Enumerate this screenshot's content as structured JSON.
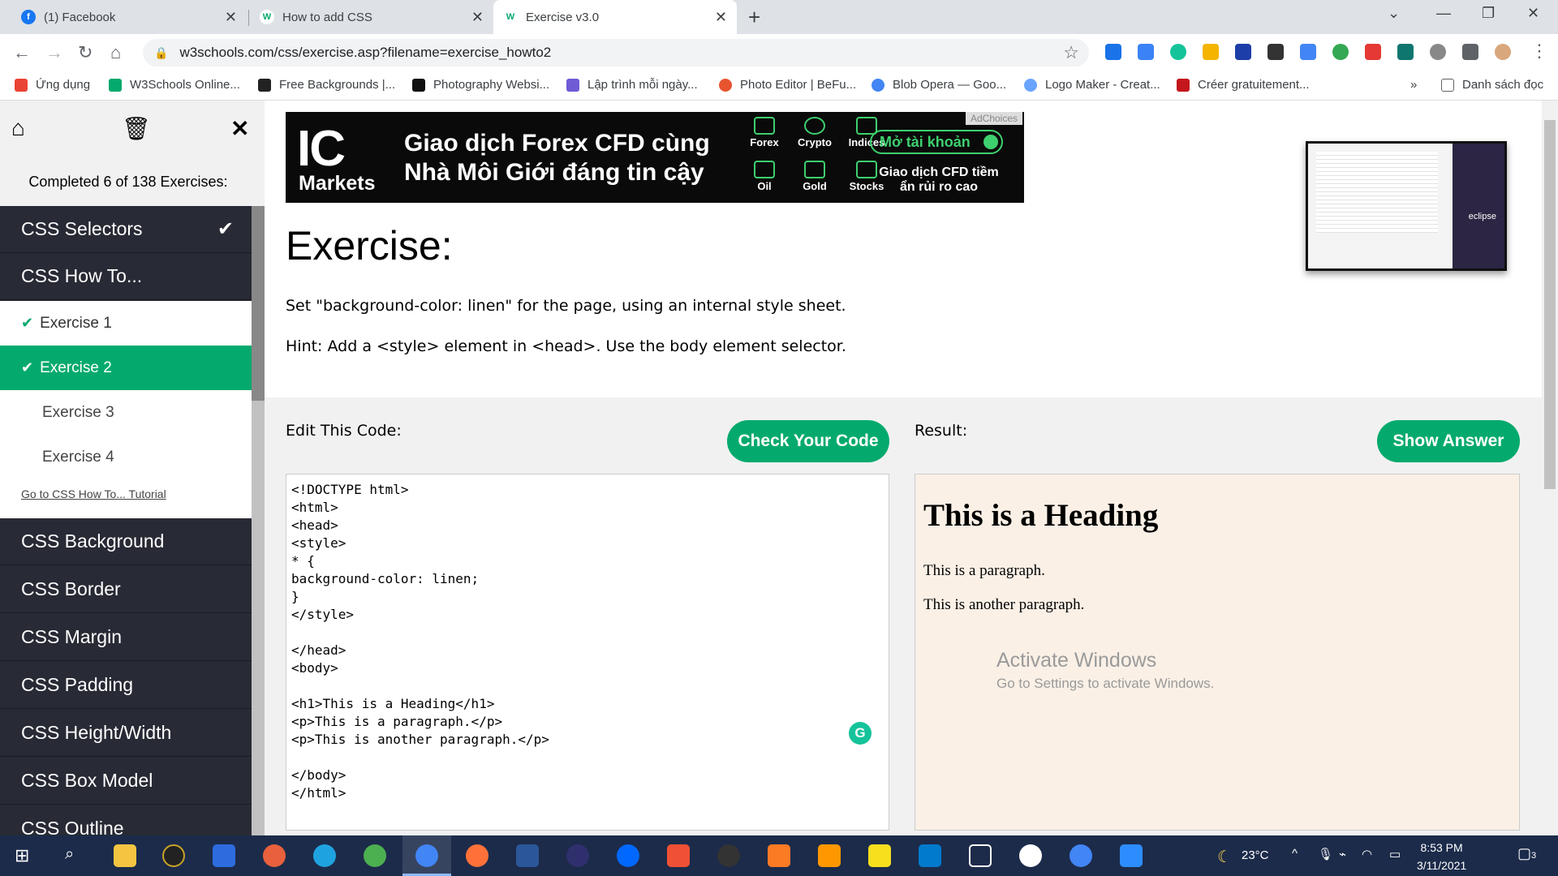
{
  "browser": {
    "tabs": [
      {
        "title": "(1) Facebook",
        "icon": "facebook-icon",
        "color": "#1877f2",
        "glyph": "f"
      },
      {
        "title": "How to add CSS",
        "icon": "w3schools-icon",
        "color": "#04aa6d",
        "glyph": "W"
      },
      {
        "title": "Exercise v3.0",
        "icon": "w3schools-icon",
        "color": "#04aa6d",
        "glyph": "W"
      }
    ],
    "url": "w3schools.com/css/exercise.asp?filename=exercise_howto2",
    "bookmarks": [
      {
        "label": "Ứng dụng",
        "icon": "apps-grid-icon",
        "color": "#ea4335"
      },
      {
        "label": "W3Schools Online...",
        "icon": "w3schools-icon",
        "color": "#04aa6d"
      },
      {
        "label": "Free Backgrounds |...",
        "icon": "image-icon",
        "color": "#222222"
      },
      {
        "label": "Photography Websi...",
        "icon": "wix-icon",
        "color": "#111111"
      },
      {
        "label": "Lập trình mỗi ngày...",
        "icon": "code-icon",
        "color": "#6f5bd6"
      },
      {
        "label": "Photo Editor | BeFu...",
        "icon": "befunky-icon",
        "color": "#e8542e"
      },
      {
        "label": "Blob Opera — Goo...",
        "icon": "opera-icon",
        "color": "#4285f4"
      },
      {
        "label": "Logo Maker - Creat...",
        "icon": "logo-maker-icon",
        "color": "#6aa4ff"
      },
      {
        "label": "Créer gratuitement...",
        "icon": "spark-icon",
        "color": "#c4161c"
      }
    ],
    "reading_list": "Danh sách đọc"
  },
  "sidebar": {
    "completed": "Completed 6 of 138 Exercises:",
    "top_items": [
      {
        "label": "CSS Selectors",
        "done": true
      },
      {
        "label": "CSS How To...",
        "done": false
      }
    ],
    "sub_items": [
      {
        "label": "Exercise 1",
        "state": "done"
      },
      {
        "label": "Exercise 2",
        "state": "active"
      },
      {
        "label": "Exercise 3",
        "state": "todo"
      },
      {
        "label": "Exercise 4",
        "state": "todo"
      }
    ],
    "tutorial_link": "Go to CSS How To... Tutorial",
    "bottom_items": [
      "CSS Background",
      "CSS Border",
      "CSS Margin",
      "CSS Padding",
      "CSS Height/Width",
      "CSS Box Model",
      "CSS Outline"
    ]
  },
  "ad": {
    "logo": "IC",
    "logo_sub": "Markets",
    "line1": "Giao dịch Forex CFD cùng",
    "line2": "Nhà Môi Giới đáng tin cậy",
    "assets": [
      "Forex",
      "Crypto",
      "Indices",
      "Oil",
      "Gold",
      "Stocks"
    ],
    "cta": "Mở tài khoản",
    "cta_sub": "Giao dịch CFD tiềm ẩn rủi ro cao",
    "choices": "AdChoices"
  },
  "video": {
    "label": "eclipse"
  },
  "exercise": {
    "title": "Exercise:",
    "instruction": "Set \"background-color: linen\" for the page, using an internal style sheet.",
    "hint": "Hint: Add a <style> element in <head>. Use the body element selector.",
    "edit_label": "Edit This Code:",
    "check_button": "Check Your Code",
    "result_label": "Result:",
    "answer_button": "Show Answer",
    "code": "<!DOCTYPE html>\n<html>\n<head>\n<style>\n* {\nbackground-color: linen;\n}\n</style>\n\n</head>\n<body>\n\n<h1>This is a Heading</h1>\n<p>This is a paragraph.</p>\n<p>This is another paragraph.</p>\n\n</body>\n</html>",
    "result": {
      "heading": "This is a Heading",
      "p1": "This is a paragraph.",
      "p2": "This is another paragraph.",
      "background": "#faf0e6"
    }
  },
  "windows": {
    "activate_title": "Activate Windows",
    "activate_sub": "Go to Settings to activate Windows.",
    "temperature": "23°C",
    "time": "8:53 PM",
    "date": "3/11/2021",
    "notification_count": "3"
  },
  "colors": {
    "accent": "#04aa6d",
    "sidebar": "#282a35"
  }
}
